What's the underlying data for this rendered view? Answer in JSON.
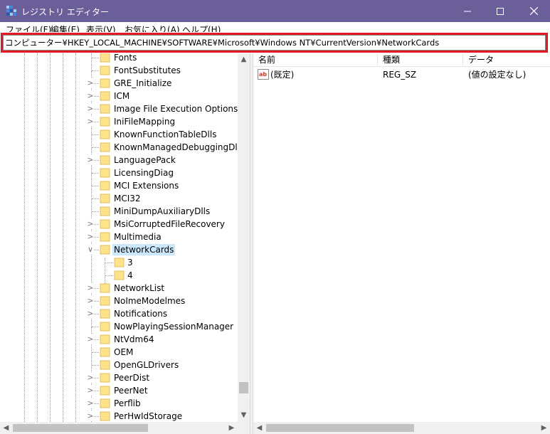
{
  "window": {
    "title": "レジストリ エディター",
    "minimize_icon": "minimize-icon",
    "maximize_icon": "maximize-icon",
    "close_icon": "close-icon",
    "titlebar_color": "#6b5f9a"
  },
  "menu": [
    {
      "label": "ファイル(F)"
    },
    {
      "label": "編集(E)"
    },
    {
      "label": "表示(V)"
    },
    {
      "label": "お気に入り(A)"
    },
    {
      "label": "ヘルプ(H)"
    }
  ],
  "address": {
    "value": "コンピューター¥HKEY_LOCAL_MACHINE¥SOFTWARE¥Microsoft¥Windows NT¥CurrentVersion¥NetworkCards",
    "highlight_color": "#e21b23"
  },
  "tree": {
    "items": [
      {
        "label": "Fonts",
        "expandable": false
      },
      {
        "label": "FontSubstitutes",
        "expandable": false
      },
      {
        "label": "GRE_Initialize",
        "expandable": true
      },
      {
        "label": "ICM",
        "expandable": true
      },
      {
        "label": "Image File Execution Options",
        "expandable": true
      },
      {
        "label": "IniFileMapping",
        "expandable": true
      },
      {
        "label": "KnownFunctionTableDlls",
        "expandable": false
      },
      {
        "label": "KnownManagedDebuggingDlls",
        "expandable": false
      },
      {
        "label": "LanguagePack",
        "expandable": true
      },
      {
        "label": "LicensingDiag",
        "expandable": false
      },
      {
        "label": "MCI Extensions",
        "expandable": false
      },
      {
        "label": "MCI32",
        "expandable": false
      },
      {
        "label": "MiniDumpAuxiliaryDlls",
        "expandable": false
      },
      {
        "label": "MsiCorruptedFileRecovery",
        "expandable": true
      },
      {
        "label": "Multimedia",
        "expandable": true
      },
      {
        "label": "NetworkCards",
        "expandable": true,
        "expanded": true,
        "selected": true
      },
      {
        "label": "3",
        "child": true
      },
      {
        "label": "4",
        "child": true
      },
      {
        "label": "NetworkList",
        "expandable": true
      },
      {
        "label": "NoImeModelmes",
        "expandable": true
      },
      {
        "label": "Notifications",
        "expandable": true
      },
      {
        "label": "NowPlayingSessionManager",
        "expandable": false
      },
      {
        "label": "NtVdm64",
        "expandable": true
      },
      {
        "label": "OEM",
        "expandable": false
      },
      {
        "label": "OpenGLDrivers",
        "expandable": false
      },
      {
        "label": "PeerDist",
        "expandable": true
      },
      {
        "label": "PeerNet",
        "expandable": true
      },
      {
        "label": "Perflib",
        "expandable": true
      },
      {
        "label": "PerHwIdStorage",
        "expandable": true
      }
    ],
    "folder_color": "#ffe38a",
    "selected_color": "#cce8ff"
  },
  "list": {
    "columns": [
      {
        "label": "名前"
      },
      {
        "label": "種類"
      },
      {
        "label": "データ"
      }
    ],
    "rows": [
      {
        "name": "(既定)",
        "type": "REG_SZ",
        "data": "(値の設定なし)",
        "icon": "reg-sz-icon"
      }
    ]
  }
}
